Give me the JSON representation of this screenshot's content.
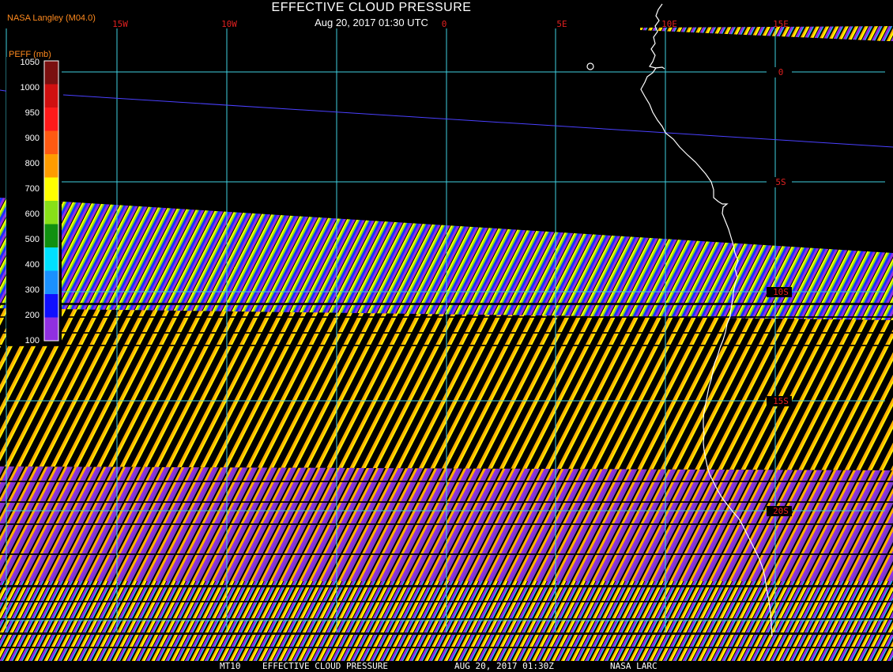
{
  "title": "EFFECTIVE CLOUD PRESSURE",
  "subtitle": "Aug 20, 2017 01:30 UTC",
  "producer": "NASA Langley (M04.0)",
  "legend": {
    "units_label": "PEFF (mb)",
    "levels": [
      "1050",
      "1000",
      "950",
      "900",
      "800",
      "700",
      "600",
      "500",
      "400",
      "300",
      "200",
      "100"
    ],
    "colors": [
      "#7a1010",
      "#d01010",
      "#ff1a1a",
      "#ff5a12",
      "#ff9c00",
      "#ffff00",
      "#88e018",
      "#109010",
      "#00e0ff",
      "#1a90ff",
      "#1010ff",
      "#9030e0"
    ]
  },
  "map": {
    "longitude_labels": [
      "15W",
      "10W",
      "0",
      "5E",
      "10E",
      "15E"
    ],
    "latitude_labels": [
      "0",
      "5S",
      "10S",
      "15S",
      "20S"
    ],
    "grid_color": "#40d0e0",
    "coastline_color": "#ffffff",
    "label_color": "#e02020",
    "swath_colors": [
      "#ff9c00",
      "#ffff00",
      "#1010ff",
      "#9030e0",
      "#00e0ff",
      "#88e018"
    ]
  },
  "footer": {
    "product": "MT10",
    "title": "EFFECTIVE CLOUD PRESSURE",
    "datetime": "AUG 20, 2017 01:30Z",
    "source": "NASA LARC"
  }
}
